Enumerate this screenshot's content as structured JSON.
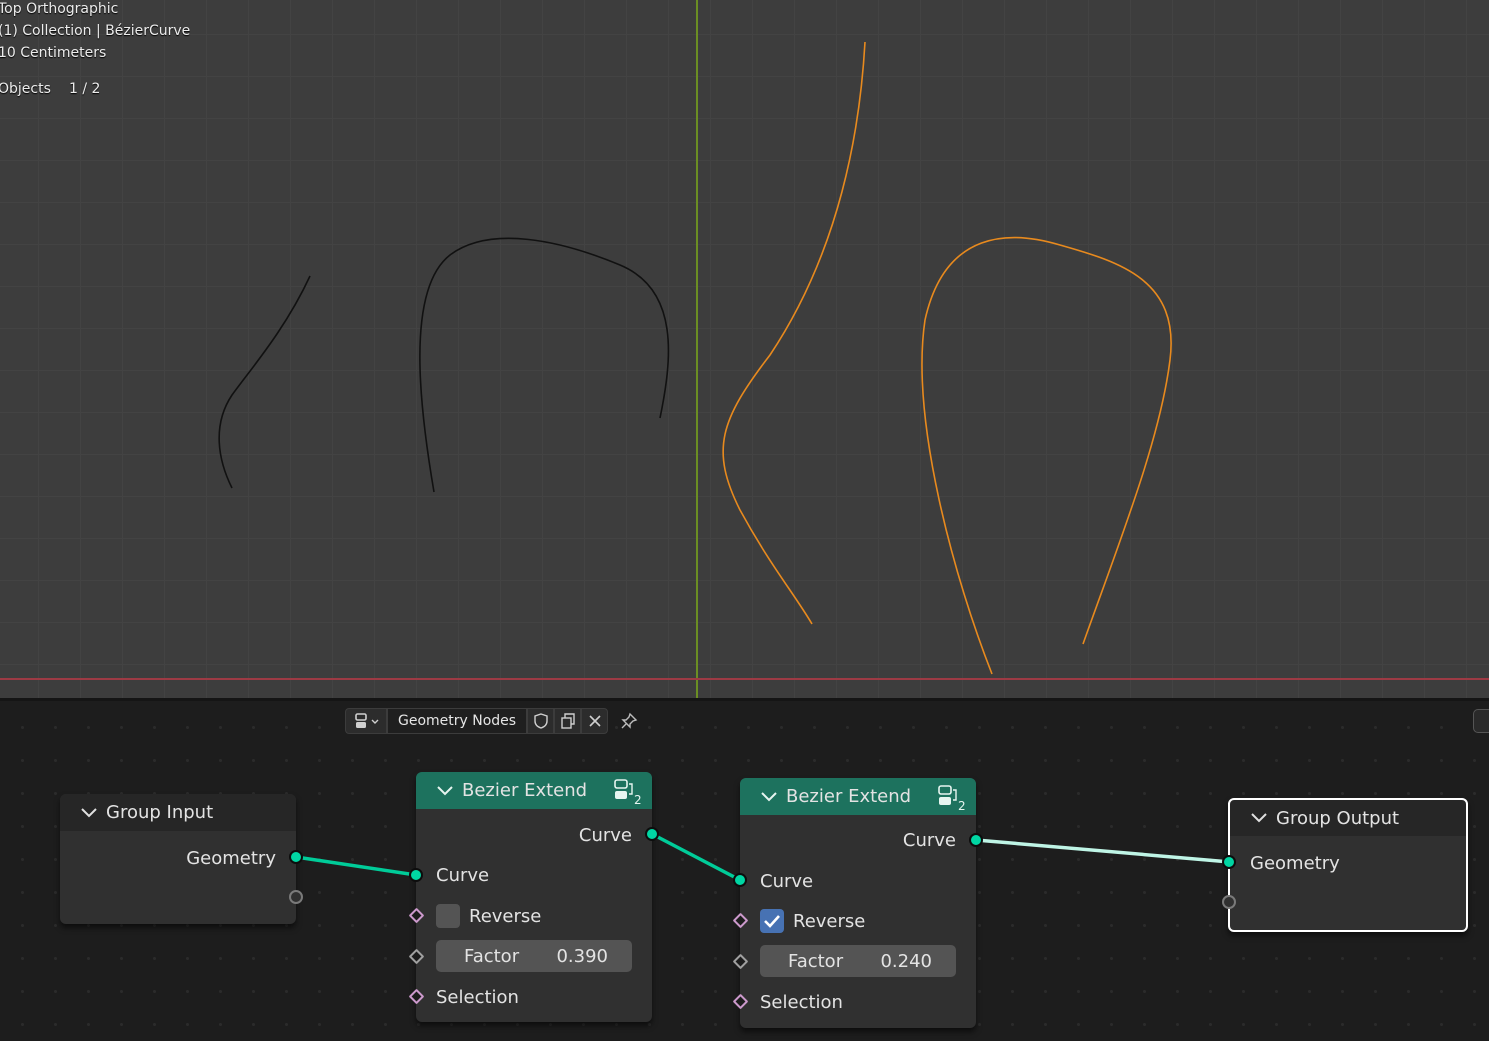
{
  "viewport": {
    "view_name": "Top Orthographic",
    "collection_line": "(1) Collection | BézierCurve",
    "scale_line": "10 Centimeters",
    "objects_label": "Objects",
    "objects_count": "1 / 2",
    "colors": {
      "selected_curve": "#e88a1e",
      "unselected_curve": "#111111",
      "y_axis": "#6b8e23",
      "x_axis": "#9d3a44"
    }
  },
  "node_editor": {
    "header": {
      "tree_name": "Geometry Nodes"
    },
    "nodes": {
      "group_input": {
        "title": "Group Input",
        "output_geometry": "Geometry"
      },
      "bezier_extend_1": {
        "title": "Bezier Extend",
        "user_count": "2",
        "output_curve": "Curve",
        "input_curve": "Curve",
        "reverse_label": "Reverse",
        "reverse_checked": false,
        "factor_label": "Factor",
        "factor_value": "0.390",
        "selection_label": "Selection"
      },
      "bezier_extend_2": {
        "title": "Bezier Extend",
        "user_count": "2",
        "output_curve": "Curve",
        "input_curve": "Curve",
        "reverse_label": "Reverse",
        "reverse_checked": true,
        "factor_label": "Factor",
        "factor_value": "0.240",
        "selection_label": "Selection"
      },
      "group_output": {
        "title": "Group Output",
        "input_geometry": "Geometry"
      }
    },
    "colors": {
      "geometry_socket": "#00d6a3",
      "node_header_green": "#1d725e",
      "link_selected": "#bff5e6"
    }
  }
}
